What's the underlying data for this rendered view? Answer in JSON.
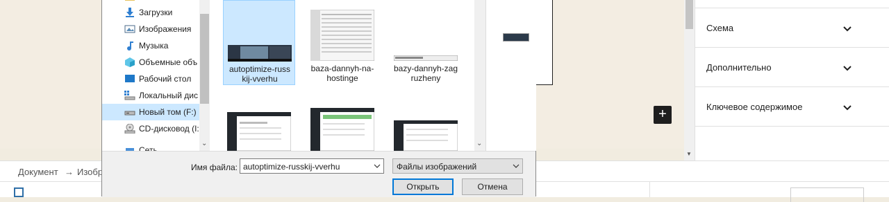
{
  "editor": {
    "add_block_label": "+",
    "breadcrumb": {
      "item1": "Документ",
      "arrow": "→",
      "item2": "Изобр"
    }
  },
  "settings_panel": {
    "sections": [
      {
        "label": "Схема"
      },
      {
        "label": "Дополнительно"
      },
      {
        "label": "Ключевое содержимое"
      }
    ]
  },
  "dialog": {
    "nav": [
      {
        "label": "",
        "icon": "folder-icon"
      },
      {
        "label": "Загрузки",
        "icon": "download-icon"
      },
      {
        "label": "Изображения",
        "icon": "pictures-icon"
      },
      {
        "label": "Музыка",
        "icon": "music-icon"
      },
      {
        "label": "Объемные объ",
        "icon": "3d-objects-icon"
      },
      {
        "label": "Рабочий стол",
        "icon": "desktop-icon"
      },
      {
        "label": "Локальный дис",
        "icon": "local-disk-icon"
      },
      {
        "label": "Новый том (F:)",
        "icon": "drive-icon",
        "selected": true
      },
      {
        "label": "CD-дисковод (I:",
        "icon": "cd-drive-icon"
      },
      {
        "label": "Сеть",
        "icon": "network-icon"
      }
    ],
    "files": [
      {
        "name": "autoptimize-russkij-vverhu",
        "caption_lines": [
          "autoptimize-russ",
          "kij-vverhu"
        ],
        "selected": true
      },
      {
        "name": "baza-dannyh-na-hostinge",
        "caption_lines": [
          "baza-dannyh-na-",
          "hostinge"
        ]
      },
      {
        "name": "bazy-dannyh-zagruzheny",
        "caption_lines": [
          "bazy-dannyh-zag",
          "ruzheny"
        ]
      },
      {
        "name": "",
        "caption_lines": []
      },
      {
        "name": "",
        "caption_lines": []
      },
      {
        "name": "",
        "caption_lines": []
      }
    ],
    "filename_label": "Имя файла:",
    "filename_value": "autoptimize-russkij-vverhu",
    "filetype_value": "Файлы изображений",
    "open_label": "Открыть",
    "cancel_label": "Отмена"
  }
}
